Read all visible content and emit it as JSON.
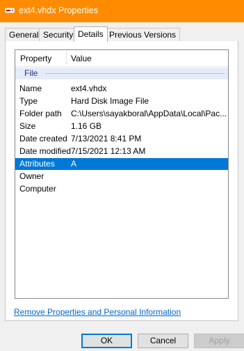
{
  "window": {
    "title": "ext4.vhdx Properties"
  },
  "tabs": [
    {
      "label": "General"
    },
    {
      "label": "Security"
    },
    {
      "label": "Details"
    },
    {
      "label": "Previous Versions"
    }
  ],
  "details": {
    "column_property": "Property",
    "column_value": "Value",
    "group": "File",
    "rows": [
      {
        "property": "Name",
        "value": "ext4.vhdx"
      },
      {
        "property": "Type",
        "value": "Hard Disk Image File"
      },
      {
        "property": "Folder path",
        "value": "C:\\Users\\sayakboral\\AppData\\Local\\Pac..."
      },
      {
        "property": "Size",
        "value": "1.16 GB"
      },
      {
        "property": "Date created",
        "value": "7/13/2021 8:41 PM"
      },
      {
        "property": "Date modified",
        "value": "7/15/2021 12:13 AM"
      },
      {
        "property": "Attributes",
        "value": "A"
      },
      {
        "property": "Owner",
        "value": ""
      },
      {
        "property": "Computer",
        "value": ""
      }
    ]
  },
  "link": {
    "text": "Remove Properties and Personal Information"
  },
  "buttons": {
    "ok": "OK",
    "cancel": "Cancel",
    "apply": "Apply"
  },
  "colors": {
    "titlebar": "#ff8c00",
    "selection": "#0078d7",
    "link": "#0066cc"
  },
  "selected_property": "Attributes",
  "active_tab": "Details"
}
